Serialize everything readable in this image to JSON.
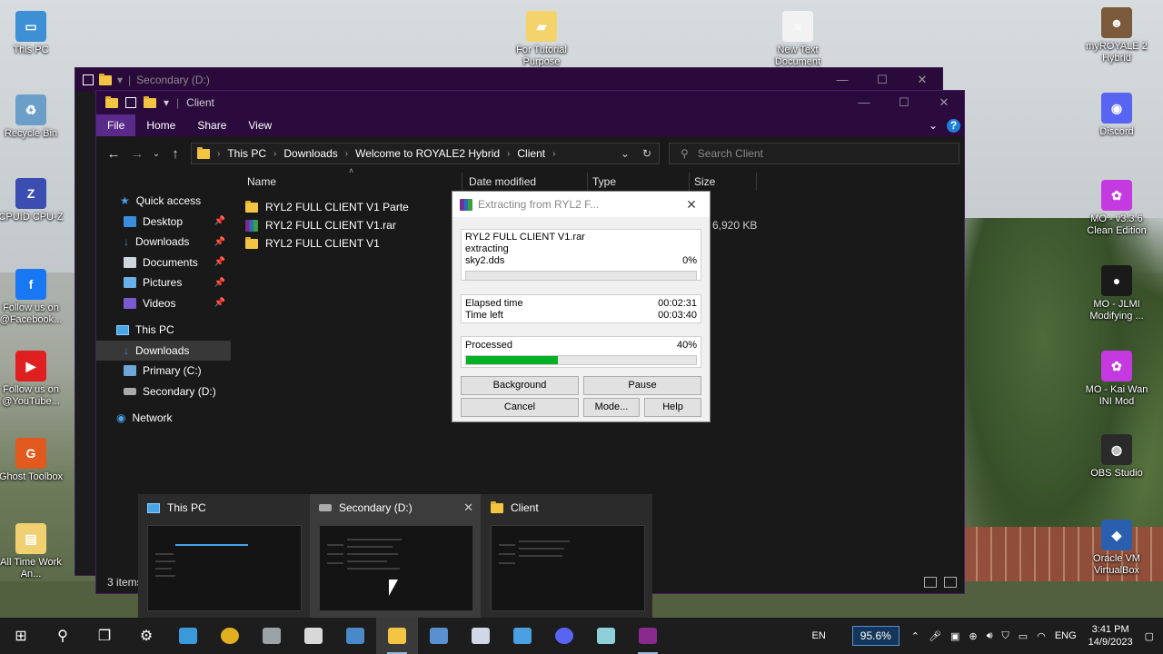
{
  "desktop": {
    "left_icons": [
      {
        "label": "This PC",
        "color": "#3d8fd6",
        "glyph": "▭"
      },
      {
        "label": "Recycle Bin",
        "color": "#6b9fc9",
        "glyph": "♻"
      },
      {
        "label": "CPUID CPU-Z",
        "color": "#3b4db0",
        "glyph": "Z"
      },
      {
        "label": "Follow us on @Facebook...",
        "color": "#1877f2",
        "glyph": "f"
      },
      {
        "label": "Follow us on @YouTube...",
        "color": "#e02020",
        "glyph": "▶"
      },
      {
        "label": "Ghost Toolbox",
        "color": "#e05a20",
        "glyph": "G"
      },
      {
        "label": "All Time Work An...",
        "color": "#f0d070",
        "glyph": "▤"
      }
    ],
    "top_icons": [
      {
        "label": "For Tutorial Purpose",
        "color": "#f3d36a",
        "glyph": "▰"
      },
      {
        "label": "New Text Document",
        "color": "#f2f2f2",
        "glyph": "≡"
      }
    ],
    "right_icons": [
      {
        "label": "myROYALE 2 Hybrid",
        "color": "#7a5a3a",
        "glyph": "☻"
      },
      {
        "label": "Discord",
        "color": "#5865f2",
        "glyph": "◉"
      },
      {
        "label": "MO - v3.3.6 Clean Edition",
        "color": "#c43ae0",
        "glyph": "✿"
      },
      {
        "label": "MO - JLMI Modifying ...",
        "color": "#1a1a1a",
        "glyph": "●"
      },
      {
        "label": "MO - Kai Wan INI Mod",
        "color": "#c43ae0",
        "glyph": "✿"
      },
      {
        "label": "OBS Studio",
        "color": "#2a2a2a",
        "glyph": "◍"
      },
      {
        "label": "Oracle VM VirtualBox",
        "color": "#2a5fb0",
        "glyph": "◆"
      }
    ]
  },
  "back_window": {
    "title": "Secondary (D:)"
  },
  "explorer": {
    "title": "Client",
    "ribbon_tabs": [
      "File",
      "Home",
      "Share",
      "View"
    ],
    "breadcrumb": [
      "This PC",
      "Downloads",
      "Welcome to ROYALE2 Hybrid",
      "Client"
    ],
    "search_placeholder": "Search Client",
    "sidebar": {
      "quick_access": "Quick access",
      "pinned": [
        "Desktop",
        "Downloads",
        "Documents",
        "Pictures",
        "Videos"
      ],
      "this_pc": "This PC",
      "this_pc_children": [
        "Downloads",
        "Primary (C:)",
        "Secondary (D:)"
      ],
      "network": "Network"
    },
    "columns": {
      "name": "Name",
      "date_modified": "Date modified",
      "type": "Type",
      "size": "Size"
    },
    "files": [
      {
        "name": "RYL2 FULL CLIENT V1 Parte",
        "kind": "folder",
        "size": ""
      },
      {
        "name": "RYL2 FULL CLIENT V1.rar",
        "kind": "rar",
        "size": "6,920 KB"
      },
      {
        "name": "RYL2 FULL CLIENT V1",
        "kind": "folder",
        "size": ""
      }
    ],
    "status": "3 items"
  },
  "winrar": {
    "title": "Extracting from RYL2 F...",
    "archive": "RYL2 FULL CLIENT V1.rar",
    "action": "extracting",
    "current_file": "sky2.dds",
    "file_percent_label": "0%",
    "file_progress": 0,
    "elapsed_label": "Elapsed time",
    "elapsed": "00:02:31",
    "left_label": "Time left",
    "left": "00:03:40",
    "processed_label": "Processed",
    "processed_percent_label": "40%",
    "processed_progress": 0.4,
    "buttons": {
      "background": "Background",
      "pause": "Pause",
      "cancel": "Cancel",
      "mode": "Mode...",
      "help": "Help"
    }
  },
  "thumbnails": [
    {
      "title": "This PC"
    },
    {
      "title": "Secondary (D:)"
    },
    {
      "title": "Client"
    }
  ],
  "taskbar": {
    "apps": [
      {
        "name": "start",
        "glyph": "⊞",
        "color": ""
      },
      {
        "name": "search",
        "glyph": "⚲",
        "color": ""
      },
      {
        "name": "task-view",
        "glyph": "❐",
        "color": ""
      },
      {
        "name": "settings",
        "glyph": "⚙",
        "color": ""
      },
      {
        "name": "app-blue",
        "glyph": "",
        "color": "#3a9ad9"
      },
      {
        "name": "chrome",
        "glyph": "",
        "color": "#e0b020"
      },
      {
        "name": "app-gray",
        "glyph": "",
        "color": "#9aa3a8"
      },
      {
        "name": "calendar-app",
        "glyph": "",
        "color": "#d8d8d8"
      },
      {
        "name": "monitor-app",
        "glyph": "",
        "color": "#4a88c8"
      },
      {
        "name": "file-explorer",
        "glyph": "",
        "color": "#f4c542"
      },
      {
        "name": "app-blue2",
        "glyph": "",
        "color": "#5a90d0"
      },
      {
        "name": "virtualbox",
        "glyph": "",
        "color": "#d0d8e8"
      },
      {
        "name": "app-cube",
        "glyph": "",
        "color": "#4aa0e0"
      },
      {
        "name": "discord-app",
        "glyph": "",
        "color": "#5865f2"
      },
      {
        "name": "notepad-app",
        "glyph": "",
        "color": "#8fd0d8"
      },
      {
        "name": "winrar",
        "glyph": "",
        "color": "#8a2a8f"
      }
    ],
    "en_label": "EN",
    "zoom": "95.6%",
    "lang": "ENG",
    "time": "3:41 PM",
    "date": "14/9/2023"
  }
}
